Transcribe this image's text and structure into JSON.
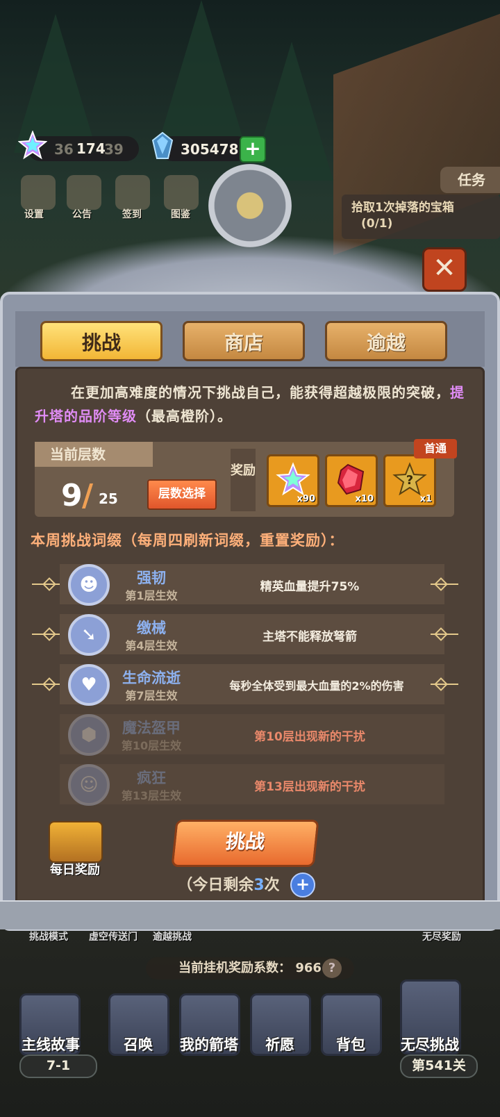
{
  "resources": {
    "stars_value": "174",
    "stars_ghost_left": "36",
    "stars_ghost_right": "39",
    "gems_value": "305478"
  },
  "top_icons": [
    "设置",
    "公告",
    "签到",
    "图鉴"
  ],
  "quest": {
    "tab_label": "任务",
    "text": "拾取1次掉落的宝箱",
    "progress": "(0/1)"
  },
  "tabs": [
    {
      "label": "挑战",
      "active": true
    },
    {
      "label": "商店",
      "active": false
    },
    {
      "label": "逾越",
      "active": false
    }
  ],
  "description": {
    "part1": "在更加高难度的情况下挑战自己，能获得超越极限的突破，",
    "highlight": "提升塔的品阶等级",
    "part2": "（最高橙阶）。"
  },
  "level": {
    "header": "当前层数",
    "current": "9",
    "slash": "/",
    "total": "25",
    "select_button": "层数选择"
  },
  "reward": {
    "label": "奖励",
    "first_clear_badge": "首通",
    "items": [
      {
        "icon": "rainbow-star-icon",
        "count": "x90"
      },
      {
        "icon": "red-crystal-icon",
        "count": "x10"
      },
      {
        "icon": "mystery-box-icon",
        "count": "x1"
      }
    ]
  },
  "weekly_title": "本周挑战词缀（每周四刷新词缀，重置奖励）：",
  "affixes": [
    {
      "icon": "demon-plus-icon",
      "name": "强韧",
      "floor": "第1层生效",
      "effect": "精英血量提升75%",
      "locked": false
    },
    {
      "icon": "arrow-down-icon",
      "name": "缴械",
      "floor": "第4层生效",
      "effect": "主塔不能释放弩箭",
      "locked": false
    },
    {
      "icon": "broken-heart-icon",
      "name": "生命流逝",
      "floor": "第7层生效",
      "effect": "每秒全体受到最大血量的2%的伤害",
      "locked": false
    },
    {
      "icon": "honeycomb-icon",
      "name": "魔法盔甲",
      "floor": "第10层生效",
      "effect": "第10层出现新的干扰",
      "locked": true
    },
    {
      "icon": "grin-face-icon",
      "name": "疯狂",
      "floor": "第13层生效",
      "effect": "第13层出现新的干扰",
      "locked": true
    }
  ],
  "daily_reward_label": "每日奖励",
  "challenge_button": "挑战",
  "remaining": {
    "prefix": "（今日剩余",
    "count": "3",
    "suffix": "次",
    "close": "）"
  },
  "modes": [
    "挑战模式",
    "虚空传送门",
    "逾越挑战",
    "无尽奖励"
  ],
  "idle_coef": {
    "label": "当前挂机奖励系数：",
    "value": "966",
    "help": "?"
  },
  "bottom_nav": [
    {
      "label": "主线故事",
      "sub": "7-1"
    },
    {
      "label": "召唤",
      "sub": ""
    },
    {
      "label": "我的箭塔",
      "sub": ""
    },
    {
      "label": "祈愿",
      "sub": ""
    },
    {
      "label": "背包",
      "sub": ""
    },
    {
      "label": "无尽挑战",
      "sub": "第541关"
    }
  ]
}
